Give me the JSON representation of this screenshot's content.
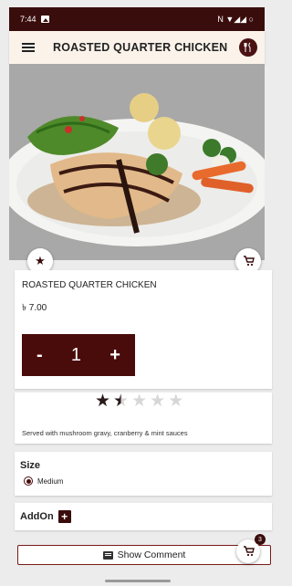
{
  "status_bar": {
    "time": "7:44",
    "right_icons": "N ▼◢◢ ○"
  },
  "appbar": {
    "title": "ROASTED QUARTER CHICKEN"
  },
  "product": {
    "name": "ROASTED QUARTER CHICKEN",
    "price": "৳ 7.00",
    "quantity": "1",
    "minus_label": "-",
    "plus_label": "+",
    "rating": 1.5,
    "rating_max": 5,
    "description": "Served with mushroom gravy, cranberry & mint sauces"
  },
  "size": {
    "label": "Size",
    "selected": "Medium"
  },
  "addon": {
    "label": "AddOn",
    "button": "+"
  },
  "show_comment": {
    "label": "Show Comment"
  },
  "cart": {
    "badge": "3"
  },
  "icons": {
    "menu": "hamburger-icon",
    "cutlery": "cutlery-icon",
    "favorite": "star-icon",
    "cart": "cart-icon",
    "comment": "comment-icon"
  },
  "colors": {
    "primary": "#3a0d0d",
    "appbar_bg": "#fbf3ea",
    "accent_border": "#7a1a1a"
  }
}
